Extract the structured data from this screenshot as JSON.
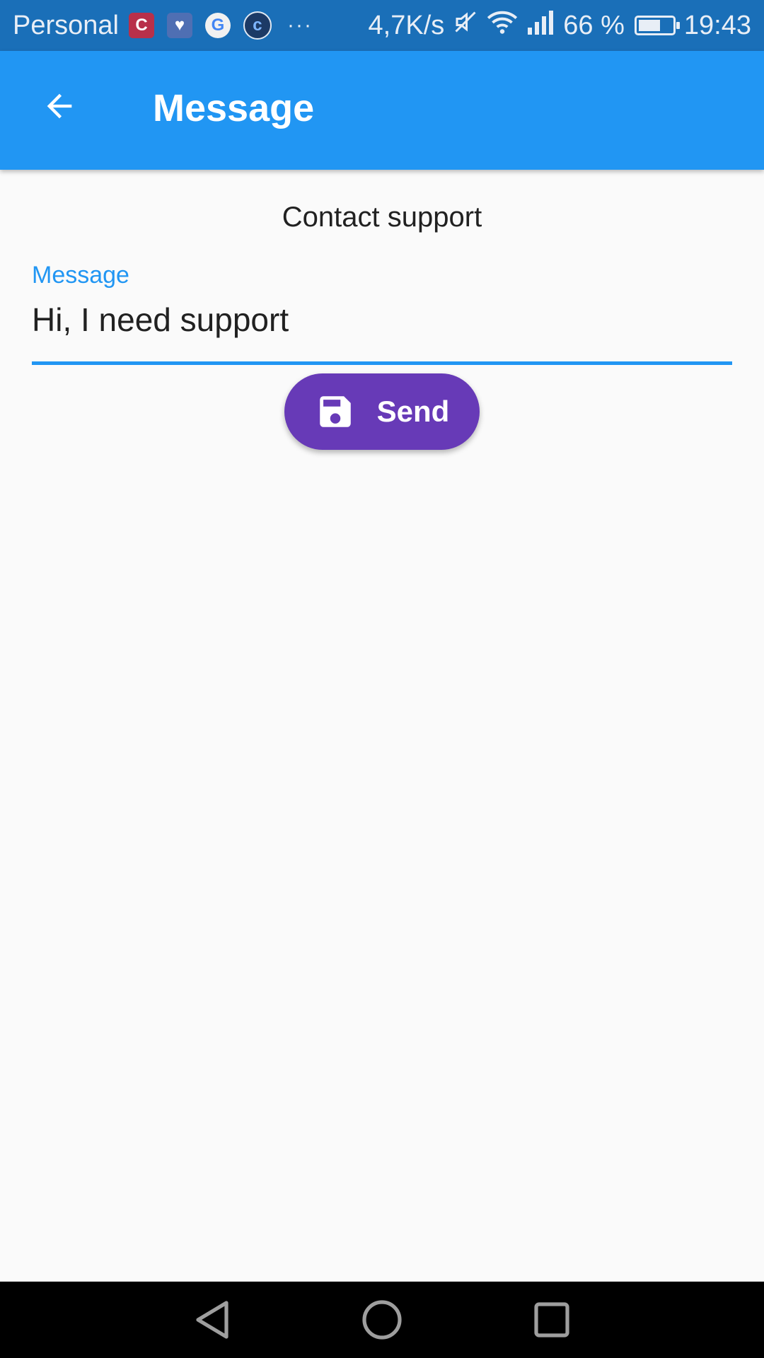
{
  "status_bar": {
    "carrier": "Personal",
    "more_label": "···",
    "speed": "4,7K/s",
    "battery_percent": "66 %",
    "battery_level": 0.66,
    "time": "19:43",
    "notification_icons": [
      "c-app-icon",
      "health-icon",
      "google-icon",
      "c-circle-icon"
    ]
  },
  "app_bar": {
    "title": "Message"
  },
  "content": {
    "title": "Contact support"
  },
  "message_field": {
    "label": "Message",
    "value": "Hi, I need support"
  },
  "send_button": {
    "label": "Send",
    "icon": "save-icon"
  },
  "colors": {
    "status_bar": "#1a6fb8",
    "app_bar": "#2196f3",
    "accent": "#2196f3",
    "button": "#673ab7",
    "background": "#fafafa"
  },
  "nav_bar": {
    "buttons": [
      "back-triangle-icon",
      "home-circle-icon",
      "recents-square-icon"
    ]
  }
}
